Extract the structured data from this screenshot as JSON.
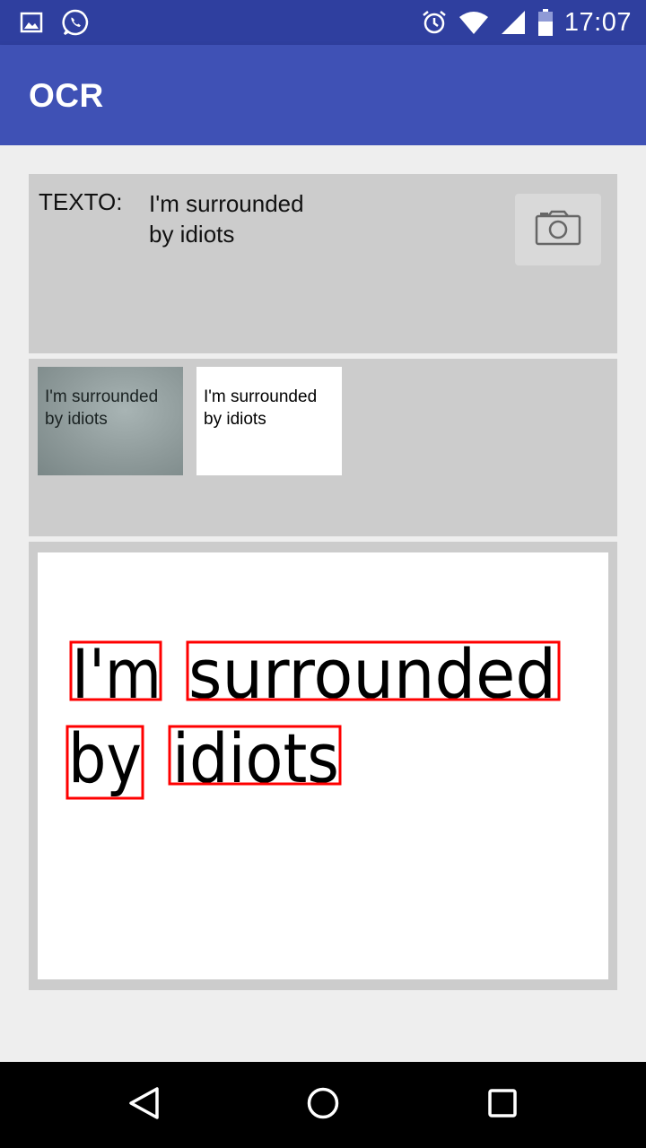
{
  "status_bar": {
    "time": "17:07",
    "left_icons": [
      "image-notification-icon",
      "whatsapp-icon"
    ],
    "right_icons": [
      "alarm-icon",
      "wifi-icon",
      "cell-signal-icon",
      "battery-icon"
    ]
  },
  "app_bar": {
    "title": "OCR",
    "color": "#3f51b5"
  },
  "text_panel": {
    "label": "TEXTO:",
    "line1": "I'm surrounded",
    "line2": "by idiots",
    "camera_icon": "camera-icon"
  },
  "thumbnails": {
    "original": {
      "line1": "I'm surrounded",
      "line2": "by idiots"
    },
    "processed": {
      "line1": "I'm surrounded",
      "line2": "by idiots"
    }
  },
  "result": {
    "words": [
      "I'm",
      "surrounded",
      "by",
      "idiots"
    ],
    "box_color": "#ff0000"
  },
  "nav_bar": {
    "buttons": [
      "back-icon",
      "home-icon",
      "recents-icon"
    ]
  }
}
